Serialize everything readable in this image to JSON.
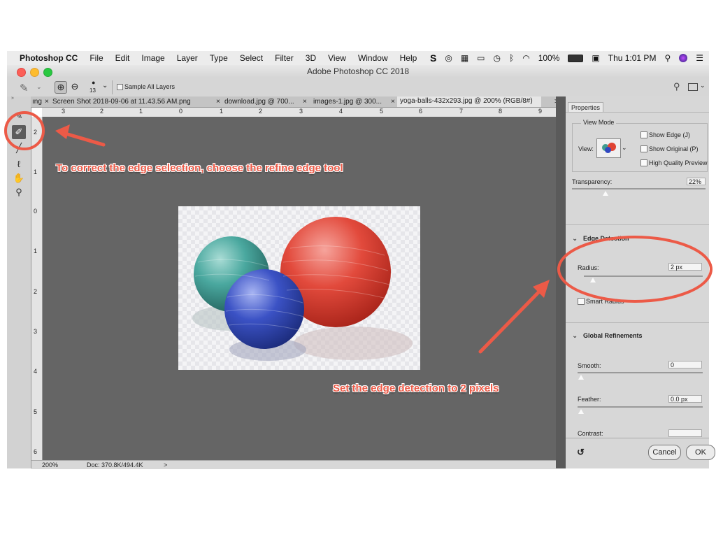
{
  "menubar": {
    "app_name": "Photoshop CC",
    "items": [
      "File",
      "Edit",
      "Image",
      "Layer",
      "Type",
      "Select",
      "Filter",
      "3D",
      "View",
      "Window",
      "Help"
    ],
    "battery": "100%",
    "clock": "Thu 1:01 PM"
  },
  "window": {
    "title": "Adobe Photoshop CC 2018"
  },
  "options_bar": {
    "brush_size": "13",
    "sample_all_layers": "Sample All Layers"
  },
  "tabs": [
    {
      "label": "ıng",
      "closable": false
    },
    {
      "label": "Screen Shot 2018-09-06 at 11.43.56 AM.png",
      "closable": true
    },
    {
      "label": "download.jpg @ 700...",
      "closable": true
    },
    {
      "label": "images-1.jpg @ 300...",
      "closable": true
    },
    {
      "label": "yoga-balls-432x293.jpg @ 200% (RGB/8#)",
      "closable": true
    }
  ],
  "tabs_overflow": ">>",
  "rulers": {
    "horizontal": [
      "3",
      "2",
      "1",
      "0",
      "1",
      "2",
      "3",
      "4",
      "5",
      "6",
      "7",
      "8",
      "9"
    ],
    "vertical": [
      "2",
      "1",
      "0",
      "1",
      "2",
      "3",
      "4",
      "5",
      "6"
    ]
  },
  "status": {
    "zoom": "200%",
    "doc": "Doc: 370.8K/494.4K",
    "arrow": ">"
  },
  "panel": {
    "tab": "Properties",
    "view_mode": {
      "title": "View Mode",
      "view_label": "View:",
      "show_edge": "Show Edge (J)",
      "show_original": "Show Original (P)",
      "high_quality": "High Quality Preview"
    },
    "transparency": {
      "label": "Transparency:",
      "value": "22%",
      "level": 0.22
    },
    "edge_detection": {
      "title": "Edge Detection",
      "radius_label": "Radius:",
      "radius_value": "2 px",
      "smart_radius": "Smart Radius"
    },
    "global_refinements": {
      "title": "Global Refinements",
      "smooth_label": "Smooth:",
      "smooth_value": "0",
      "feather_label": "Feather:",
      "feather_value": "0.0 px",
      "contrast_label": "Contrast:"
    },
    "buttons": {
      "cancel": "Cancel",
      "ok": "OK"
    }
  },
  "annotations": {
    "tool_note": "To correct the edge selection, choose the refine edge tool",
    "radius_note": "Set the edge detection to 2 pixels",
    "color": "#ec5a47"
  }
}
